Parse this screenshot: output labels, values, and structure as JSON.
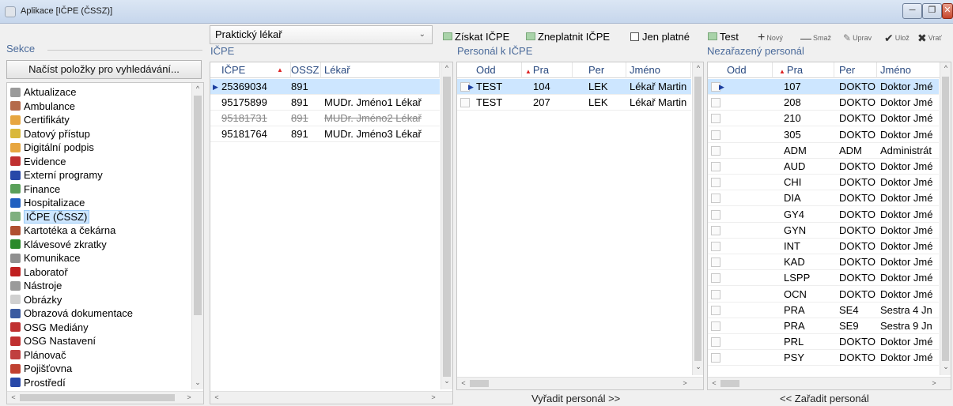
{
  "window": {
    "title": "Aplikace [IČPE (ČSSZ)]"
  },
  "sekce": {
    "label": "Sekce",
    "load_button": "Načíst položky pro vyhledávání...",
    "items": [
      {
        "label": "Aktualizace",
        "icon": "gear-icon",
        "color": "#9a9a9a"
      },
      {
        "label": "Ambulance",
        "icon": "ambulance-icon",
        "color": "#b56a4a"
      },
      {
        "label": "Certifikáty",
        "icon": "certificate-icon",
        "color": "#e7a640"
      },
      {
        "label": "Datový přístup",
        "icon": "pencil-icon",
        "color": "#d9b83a"
      },
      {
        "label": "Digitální podpis",
        "icon": "signature-icon",
        "color": "#e7a640"
      },
      {
        "label": "Evidence",
        "icon": "flag-icon",
        "color": "#c03030"
      },
      {
        "label": "Externí programy",
        "icon": "monitor-icon",
        "color": "#2848a8"
      },
      {
        "label": "Finance",
        "icon": "money-icon",
        "color": "#5aa05a"
      },
      {
        "label": "Hospitalizace",
        "icon": "hospital-icon",
        "color": "#1f5fc0"
      },
      {
        "label": "IČPE (ČSSZ)",
        "icon": "card-icon",
        "color": "#7fb07f"
      },
      {
        "label": "Kartotéka a čekárna",
        "icon": "people-icon",
        "color": "#b05030"
      },
      {
        "label": "Klávesové zkratky",
        "icon": "keyboard-icon",
        "color": "#2a8a2a"
      },
      {
        "label": "Komunikace",
        "icon": "antenna-icon",
        "color": "#909090"
      },
      {
        "label": "Laboratoř",
        "icon": "drop-icon",
        "color": "#c02020"
      },
      {
        "label": "Nástroje",
        "icon": "gear-icon",
        "color": "#9a9a9a"
      },
      {
        "label": "Obrázky",
        "icon": "image-icon",
        "color": "#d0d0d0"
      },
      {
        "label": "Obrazová dokumentace",
        "icon": "document-icon",
        "color": "#3a5aa0"
      },
      {
        "label": "OSG Mediány",
        "icon": "chart-icon",
        "color": "#c03030"
      },
      {
        "label": "OSG Nastavení",
        "icon": "chart-icon",
        "color": "#c03030"
      },
      {
        "label": "Plánovač",
        "icon": "calendar-icon",
        "color": "#c04040"
      },
      {
        "label": "Pojišťovna",
        "icon": "triangle-icon",
        "color": "#c04030"
      },
      {
        "label": "Prostředí",
        "icon": "monitor-icon",
        "color": "#2848a8"
      }
    ],
    "selected_index": 9
  },
  "combo": {
    "value": "Praktický lékař"
  },
  "toolbar": {
    "get": "Získat IČPE",
    "invalidate": "Zneplatnit IČPE",
    "only_valid": "Jen platné",
    "test": "Test",
    "new": "Nový",
    "delete": "Smaž",
    "edit": "Uprav",
    "save": "Ulož",
    "revert": "Vrať"
  },
  "icpe": {
    "title": "IČPE",
    "columns": [
      "IČPE",
      "OSSZ",
      "Lékař"
    ],
    "rows": [
      {
        "icpe": "25369034",
        "ossz": "891",
        "lekar": "",
        "selected": true,
        "struck": false
      },
      {
        "icpe": "95175899",
        "ossz": "891",
        "lekar": "MUDr. Jméno1 Lékař",
        "selected": false,
        "struck": false
      },
      {
        "icpe": "95181731",
        "ossz": "891",
        "lekar": "MUDr. Jméno2 Lékař",
        "selected": false,
        "struck": true
      },
      {
        "icpe": "95181764",
        "ossz": "891",
        "lekar": "MUDr. Jméno3 Lékař",
        "selected": false,
        "struck": false
      }
    ]
  },
  "personal": {
    "title": "Personál k IČPE",
    "columns": [
      "Odd",
      "Pra",
      "Per",
      "Jméno"
    ],
    "rows": [
      {
        "odd": "TEST",
        "pra": "104",
        "per": "LEK",
        "jmeno": "Lékař Martin",
        "selected": true
      },
      {
        "odd": "TEST",
        "pra": "207",
        "per": "LEK",
        "jmeno": "Lékař Martin",
        "selected": false
      }
    ],
    "remove_button": "Vyřadit personál >>"
  },
  "unassigned": {
    "title": "Nezařazený personál",
    "columns": [
      "Odd",
      "Pra",
      "Per",
      "Jméno"
    ],
    "rows": [
      {
        "odd": "",
        "pra": "107",
        "per": "DOKTO",
        "jmeno": "Doktor Jmé",
        "selected": true
      },
      {
        "odd": "",
        "pra": "208",
        "per": "DOKTO",
        "jmeno": "Doktor Jmé",
        "selected": false
      },
      {
        "odd": "",
        "pra": "210",
        "per": "DOKTO",
        "jmeno": "Doktor Jmé",
        "selected": false
      },
      {
        "odd": "",
        "pra": "305",
        "per": "DOKTO",
        "jmeno": "Doktor Jmé",
        "selected": false
      },
      {
        "odd": "",
        "pra": "ADM",
        "per": "ADM",
        "jmeno": "Administrát",
        "selected": false
      },
      {
        "odd": "",
        "pra": "AUD",
        "per": "DOKTO",
        "jmeno": "Doktor Jmé",
        "selected": false
      },
      {
        "odd": "",
        "pra": "CHI",
        "per": "DOKTO",
        "jmeno": "Doktor Jmé",
        "selected": false
      },
      {
        "odd": "",
        "pra": "DIA",
        "per": "DOKTO",
        "jmeno": "Doktor Jmé",
        "selected": false
      },
      {
        "odd": "",
        "pra": "GY4",
        "per": "DOKTO",
        "jmeno": "Doktor Jmé",
        "selected": false
      },
      {
        "odd": "",
        "pra": "GYN",
        "per": "DOKTO",
        "jmeno": "Doktor Jmé",
        "selected": false
      },
      {
        "odd": "",
        "pra": "INT",
        "per": "DOKTO",
        "jmeno": "Doktor Jmé",
        "selected": false
      },
      {
        "odd": "",
        "pra": "KAD",
        "per": "DOKTO",
        "jmeno": "Doktor Jmé",
        "selected": false
      },
      {
        "odd": "",
        "pra": "LSPP",
        "per": "DOKTO",
        "jmeno": "Doktor Jmé",
        "selected": false
      },
      {
        "odd": "",
        "pra": "OCN",
        "per": "DOKTO",
        "jmeno": "Doktor Jmé",
        "selected": false
      },
      {
        "odd": "",
        "pra": "PRA",
        "per": "SE4",
        "jmeno": "Sestra 4 Jn",
        "selected": false
      },
      {
        "odd": "",
        "pra": "PRA",
        "per": "SE9",
        "jmeno": "Sestra 9 Jn",
        "selected": false
      },
      {
        "odd": "",
        "pra": "PRL",
        "per": "DOKTO",
        "jmeno": "Doktor Jmé",
        "selected": false
      },
      {
        "odd": "",
        "pra": "PSY",
        "per": "DOKTO",
        "jmeno": "Doktor Jmé",
        "selected": false
      }
    ],
    "assign_button": "<< Zařadit personál"
  }
}
